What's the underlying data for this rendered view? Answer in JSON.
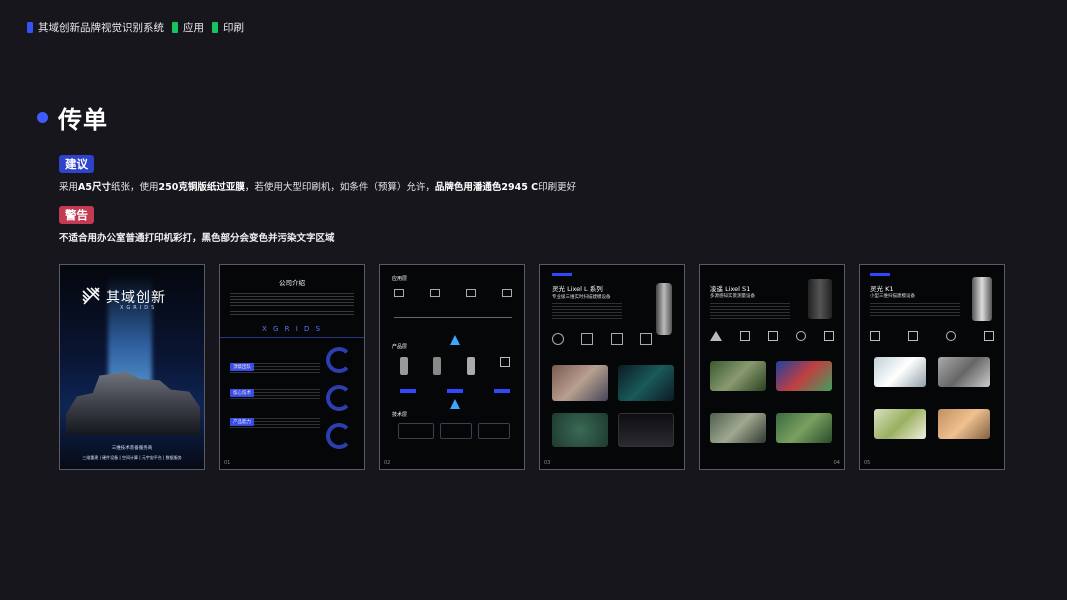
{
  "breadcrumb": {
    "items": [
      "其域创新品牌视觉识别系统",
      "应用",
      "印刷"
    ],
    "colors": {
      "first": "#3553f5",
      "rest": "#18c25f"
    }
  },
  "page": {
    "title": "传单",
    "accent": "#3d5bff"
  },
  "suggestion": {
    "badge": "建议",
    "badge_color": "#2e43c9",
    "parts": [
      "采用",
      "A5尺寸",
      "纸张，使用",
      "250克铜版纸过亚膜",
      "，若使用大型印刷机，如条件（预算）允许，",
      "品牌色用潘通色2945 C",
      "印刷更好"
    ]
  },
  "warning": {
    "badge": "警告",
    "badge_color": "#c43a53",
    "text": "不适合用办公室普通打印机彩打，黑色部分会变色并污染文字区域"
  },
  "flyers": {
    "f1": {
      "brand": "其域创新",
      "brand_en": "XGRIDS",
      "sub": "三维技术装备服务商",
      "sub2": "三维重建 | 硬件设备 | 空间计算 | 元宇宙平台 | 数据服务"
    },
    "f2": {
      "title": "公司介绍",
      "en": "X G R I D S",
      "s1": "顶级团队",
      "s2": "核心技术",
      "s3": "产品能力",
      "num": "01"
    },
    "f3": {
      "h1": "应用层",
      "h2": "产品层",
      "h3": "技术层",
      "num": "02"
    },
    "f4": {
      "title": "灵光 Lixel L 系列",
      "subtitle": "专业级三维实时扫描建模设备",
      "num": "03"
    },
    "f5": {
      "title": "凌遥 Lixel S1",
      "subtitle": "多源感知实景测量设备",
      "num": "04"
    },
    "f6": {
      "title": "灵光 K1",
      "subtitle": "小型三维扫描建模设备",
      "num": "05"
    }
  }
}
